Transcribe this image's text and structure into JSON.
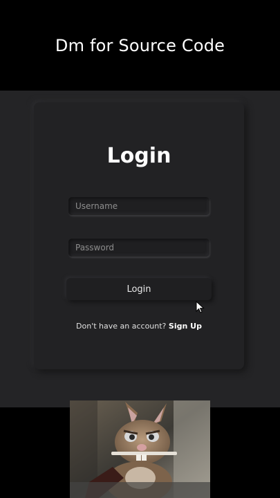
{
  "overlay": {
    "caption": "Dm for Source Code"
  },
  "login_card": {
    "title": "Login",
    "username_placeholder": "Username",
    "password_placeholder": "Password",
    "login_label": "Login",
    "signup_prompt": "Don't have an account?",
    "signup_label": "Sign Up"
  },
  "colors": {
    "background": "#000000",
    "stage": "#242426",
    "card": "#222224",
    "text": "#ffffff"
  },
  "icons": {
    "cursor": "mouse-pointer-icon"
  }
}
